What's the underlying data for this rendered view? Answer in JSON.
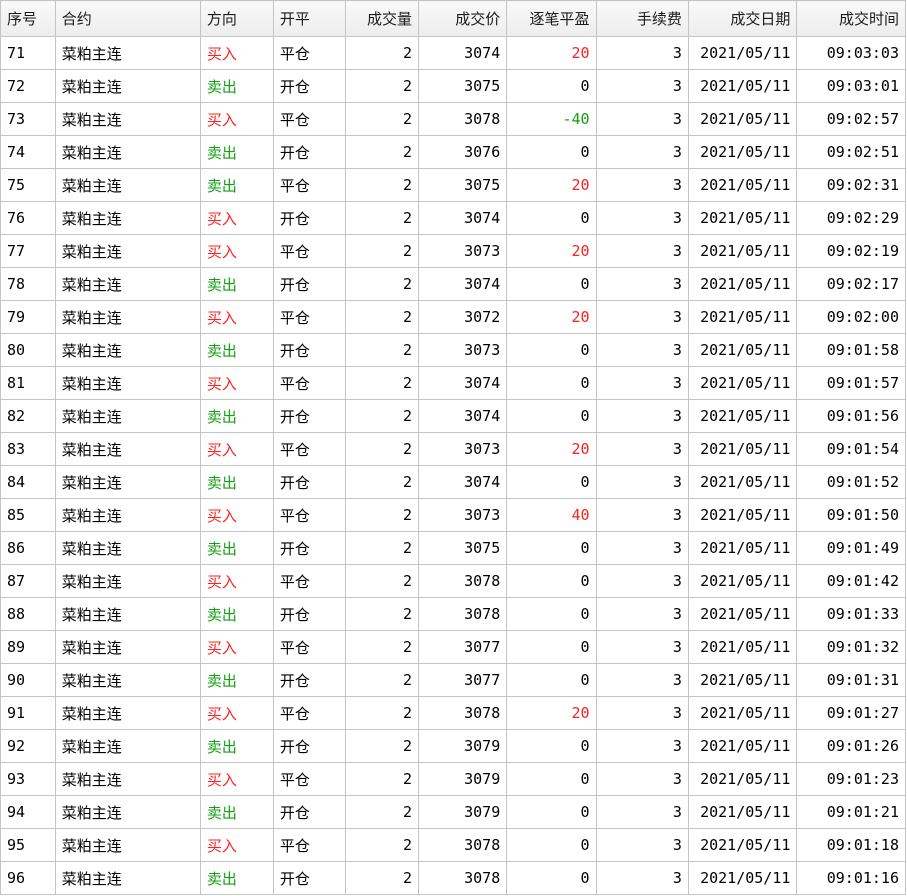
{
  "columns": [
    "序号",
    "合约",
    "方向",
    "开平",
    "成交量",
    "成交价",
    "逐笔平盈",
    "手续费",
    "成交日期",
    "成交时间"
  ],
  "colors": {
    "buy": "#ff2020",
    "sell": "#14a014",
    "loss": "#14a014",
    "profit": "#ff2020"
  },
  "rows": [
    {
      "id": "71",
      "contract": "菜粕主连",
      "dir": "买入",
      "oc": "平仓",
      "vol": "2",
      "price": "3074",
      "pnl": "20",
      "fee": "3",
      "date": "2021/05/11",
      "time": "09:03:03"
    },
    {
      "id": "72",
      "contract": "菜粕主连",
      "dir": "卖出",
      "oc": "开仓",
      "vol": "2",
      "price": "3075",
      "pnl": "0",
      "fee": "3",
      "date": "2021/05/11",
      "time": "09:03:01"
    },
    {
      "id": "73",
      "contract": "菜粕主连",
      "dir": "买入",
      "oc": "平仓",
      "vol": "2",
      "price": "3078",
      "pnl": "-40",
      "fee": "3",
      "date": "2021/05/11",
      "time": "09:02:57"
    },
    {
      "id": "74",
      "contract": "菜粕主连",
      "dir": "卖出",
      "oc": "开仓",
      "vol": "2",
      "price": "3076",
      "pnl": "0",
      "fee": "3",
      "date": "2021/05/11",
      "time": "09:02:51"
    },
    {
      "id": "75",
      "contract": "菜粕主连",
      "dir": "卖出",
      "oc": "平仓",
      "vol": "2",
      "price": "3075",
      "pnl": "20",
      "fee": "3",
      "date": "2021/05/11",
      "time": "09:02:31"
    },
    {
      "id": "76",
      "contract": "菜粕主连",
      "dir": "买入",
      "oc": "开仓",
      "vol": "2",
      "price": "3074",
      "pnl": "0",
      "fee": "3",
      "date": "2021/05/11",
      "time": "09:02:29"
    },
    {
      "id": "77",
      "contract": "菜粕主连",
      "dir": "买入",
      "oc": "平仓",
      "vol": "2",
      "price": "3073",
      "pnl": "20",
      "fee": "3",
      "date": "2021/05/11",
      "time": "09:02:19"
    },
    {
      "id": "78",
      "contract": "菜粕主连",
      "dir": "卖出",
      "oc": "开仓",
      "vol": "2",
      "price": "3074",
      "pnl": "0",
      "fee": "3",
      "date": "2021/05/11",
      "time": "09:02:17"
    },
    {
      "id": "79",
      "contract": "菜粕主连",
      "dir": "买入",
      "oc": "平仓",
      "vol": "2",
      "price": "3072",
      "pnl": "20",
      "fee": "3",
      "date": "2021/05/11",
      "time": "09:02:00"
    },
    {
      "id": "80",
      "contract": "菜粕主连",
      "dir": "卖出",
      "oc": "开仓",
      "vol": "2",
      "price": "3073",
      "pnl": "0",
      "fee": "3",
      "date": "2021/05/11",
      "time": "09:01:58"
    },
    {
      "id": "81",
      "contract": "菜粕主连",
      "dir": "买入",
      "oc": "平仓",
      "vol": "2",
      "price": "3074",
      "pnl": "0",
      "fee": "3",
      "date": "2021/05/11",
      "time": "09:01:57"
    },
    {
      "id": "82",
      "contract": "菜粕主连",
      "dir": "卖出",
      "oc": "开仓",
      "vol": "2",
      "price": "3074",
      "pnl": "0",
      "fee": "3",
      "date": "2021/05/11",
      "time": "09:01:56"
    },
    {
      "id": "83",
      "contract": "菜粕主连",
      "dir": "买入",
      "oc": "平仓",
      "vol": "2",
      "price": "3073",
      "pnl": "20",
      "fee": "3",
      "date": "2021/05/11",
      "time": "09:01:54"
    },
    {
      "id": "84",
      "contract": "菜粕主连",
      "dir": "卖出",
      "oc": "开仓",
      "vol": "2",
      "price": "3074",
      "pnl": "0",
      "fee": "3",
      "date": "2021/05/11",
      "time": "09:01:52"
    },
    {
      "id": "85",
      "contract": "菜粕主连",
      "dir": "买入",
      "oc": "平仓",
      "vol": "2",
      "price": "3073",
      "pnl": "40",
      "fee": "3",
      "date": "2021/05/11",
      "time": "09:01:50"
    },
    {
      "id": "86",
      "contract": "菜粕主连",
      "dir": "卖出",
      "oc": "开仓",
      "vol": "2",
      "price": "3075",
      "pnl": "0",
      "fee": "3",
      "date": "2021/05/11",
      "time": "09:01:49"
    },
    {
      "id": "87",
      "contract": "菜粕主连",
      "dir": "买入",
      "oc": "平仓",
      "vol": "2",
      "price": "3078",
      "pnl": "0",
      "fee": "3",
      "date": "2021/05/11",
      "time": "09:01:42"
    },
    {
      "id": "88",
      "contract": "菜粕主连",
      "dir": "卖出",
      "oc": "开仓",
      "vol": "2",
      "price": "3078",
      "pnl": "0",
      "fee": "3",
      "date": "2021/05/11",
      "time": "09:01:33"
    },
    {
      "id": "89",
      "contract": "菜粕主连",
      "dir": "买入",
      "oc": "平仓",
      "vol": "2",
      "price": "3077",
      "pnl": "0",
      "fee": "3",
      "date": "2021/05/11",
      "time": "09:01:32"
    },
    {
      "id": "90",
      "contract": "菜粕主连",
      "dir": "卖出",
      "oc": "开仓",
      "vol": "2",
      "price": "3077",
      "pnl": "0",
      "fee": "3",
      "date": "2021/05/11",
      "time": "09:01:31"
    },
    {
      "id": "91",
      "contract": "菜粕主连",
      "dir": "买入",
      "oc": "平仓",
      "vol": "2",
      "price": "3078",
      "pnl": "20",
      "fee": "3",
      "date": "2021/05/11",
      "time": "09:01:27"
    },
    {
      "id": "92",
      "contract": "菜粕主连",
      "dir": "卖出",
      "oc": "开仓",
      "vol": "2",
      "price": "3079",
      "pnl": "0",
      "fee": "3",
      "date": "2021/05/11",
      "time": "09:01:26"
    },
    {
      "id": "93",
      "contract": "菜粕主连",
      "dir": "买入",
      "oc": "平仓",
      "vol": "2",
      "price": "3079",
      "pnl": "0",
      "fee": "3",
      "date": "2021/05/11",
      "time": "09:01:23"
    },
    {
      "id": "94",
      "contract": "菜粕主连",
      "dir": "卖出",
      "oc": "开仓",
      "vol": "2",
      "price": "3079",
      "pnl": "0",
      "fee": "3",
      "date": "2021/05/11",
      "time": "09:01:21"
    },
    {
      "id": "95",
      "contract": "菜粕主连",
      "dir": "买入",
      "oc": "平仓",
      "vol": "2",
      "price": "3078",
      "pnl": "0",
      "fee": "3",
      "date": "2021/05/11",
      "time": "09:01:18"
    },
    {
      "id": "96",
      "contract": "菜粕主连",
      "dir": "卖出",
      "oc": "开仓",
      "vol": "2",
      "price": "3078",
      "pnl": "0",
      "fee": "3",
      "date": "2021/05/11",
      "time": "09:01:16"
    }
  ]
}
